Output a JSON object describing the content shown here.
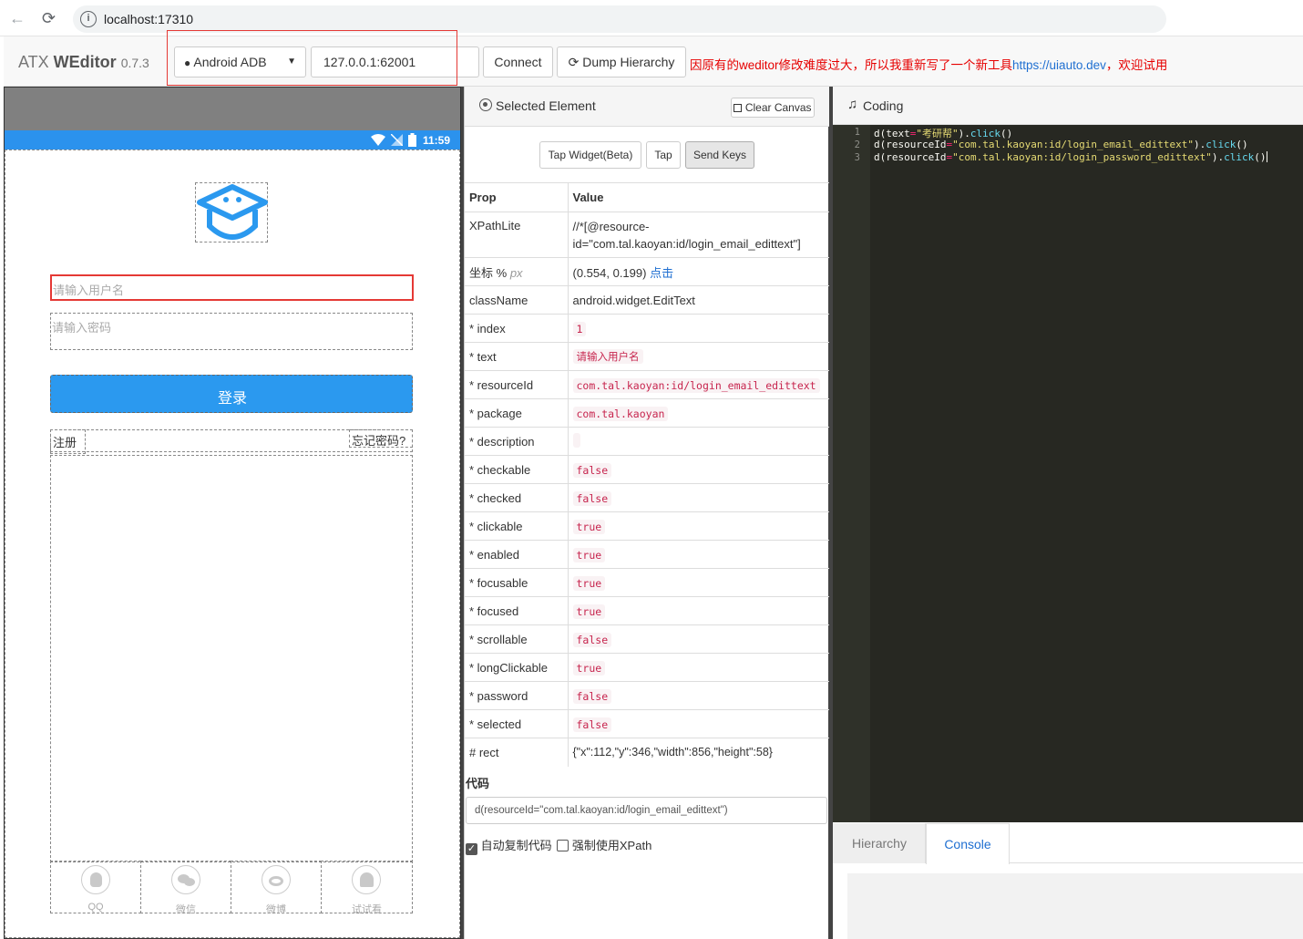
{
  "browser": {
    "url": "localhost:17310"
  },
  "app": {
    "brand_prefix": "ATX ",
    "brand_bold": "WEditor",
    "version": "0.7.3",
    "platform_select": "Android ADB",
    "address_value": "127.0.0.1:62001",
    "connect_label": "Connect",
    "dump_label": "Dump Hierarchy",
    "notice_text": "因原有的weditor修改难度过大，所以我重新写了一个新工具",
    "notice_link": "https://uiauto.dev",
    "notice_suffix": "，欢迎试用"
  },
  "phone": {
    "time": "11:59",
    "username_placeholder": "请输入用户名",
    "password_placeholder": "请输入密码",
    "login_label": "登录",
    "register_label": "注册",
    "forgot_label": "忘记密码?",
    "social": [
      "QQ",
      "微信",
      "微博",
      "试试看"
    ],
    "colors": {
      "status": "#2b92ed",
      "login_button": "#2b99ef",
      "logo": "#2b99ef"
    }
  },
  "selected": {
    "title": "Selected Element",
    "clear_label": "Clear Canvas",
    "tap_widget_label": "Tap Widget(Beta)",
    "tap_label": "Tap",
    "send_keys_label": "Send Keys",
    "header_prop": "Prop",
    "header_value": "Value",
    "xpath_key": "XPathLite",
    "xpath_value": "//*[@resource-id=\"com.tal.kaoyan:id/login_email_edittext\"]",
    "coord_key": "坐标",
    "coord_unit_pct": "%",
    "coord_unit_px": "px",
    "coord_value": "(0.554, 0.199)",
    "coord_link": "点击",
    "classname_key": "className",
    "classname_value": "android.widget.EditText",
    "props": [
      {
        "key": "* index",
        "value": "1"
      },
      {
        "key": "* text",
        "value": "请输入用户名"
      },
      {
        "key": "* resourceId",
        "value": "com.tal.kaoyan:id/login_email_edittext"
      },
      {
        "key": "* package",
        "value": "com.tal.kaoyan"
      },
      {
        "key": "* description",
        "value": ""
      },
      {
        "key": "* checkable",
        "value": "false"
      },
      {
        "key": "* checked",
        "value": "false"
      },
      {
        "key": "* clickable",
        "value": "true"
      },
      {
        "key": "* enabled",
        "value": "true"
      },
      {
        "key": "* focusable",
        "value": "true"
      },
      {
        "key": "* focused",
        "value": "true"
      },
      {
        "key": "* scrollable",
        "value": "false"
      },
      {
        "key": "* longClickable",
        "value": "true"
      },
      {
        "key": "* password",
        "value": "false"
      },
      {
        "key": "* selected",
        "value": "false"
      }
    ],
    "rect_key": "# rect",
    "rect_value": "{\"x\":112,\"y\":346,\"width\":856,\"height\":58}",
    "code_heading": "代码",
    "code_value": "d(resourceId=\"com.tal.kaoyan:id/login_email_edittext\")",
    "auto_copy_label": "自动复制代码",
    "auto_copy_checked": true,
    "force_xpath_label": "强制使用XPath",
    "force_xpath_checked": false
  },
  "coding": {
    "title": "Coding",
    "lines": [
      {
        "num": "1",
        "text": "d(text=\"考研帮\").click()"
      },
      {
        "num": "2",
        "text": "d(resourceId=\"com.tal.kaoyan:id/login_email_edittext\").click()"
      },
      {
        "num": "3",
        "text": "d(resourceId=\"com.tal.kaoyan:id/login_password_edittext\").click()"
      }
    ],
    "tab_hierarchy": "Hierarchy",
    "tab_console": "Console",
    "active_tab": "Console"
  }
}
